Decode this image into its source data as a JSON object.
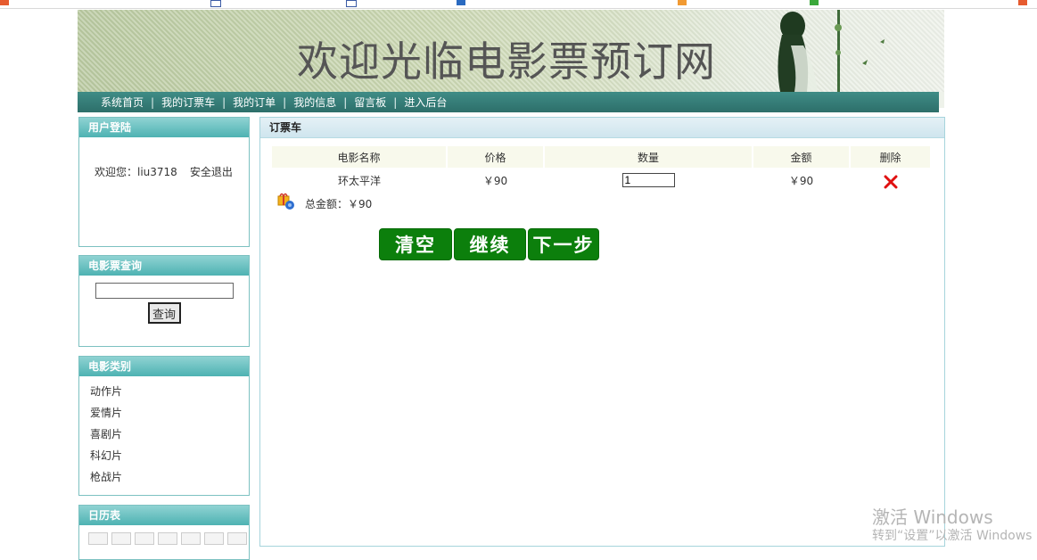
{
  "header": {
    "title": "欢迎光临电影票预订网"
  },
  "nav": {
    "items": [
      {
        "label": "系统首页"
      },
      {
        "label": "我的订票车"
      },
      {
        "label": "我的订单"
      },
      {
        "label": "我的信息"
      },
      {
        "label": "留言板"
      },
      {
        "label": "进入后台"
      }
    ]
  },
  "login_box": {
    "title": "用户登陆",
    "welcome": "欢迎您：liu3718",
    "logout": "安全退出"
  },
  "search_box": {
    "title": "电影票查询",
    "input_value": "",
    "button_label": "查询"
  },
  "category_box": {
    "title": "电影类别",
    "items": [
      "动作片",
      "爱情片",
      "喜剧片",
      "科幻片",
      "枪战片"
    ]
  },
  "calendar_box": {
    "title": "日历表"
  },
  "cart": {
    "title": "订票车",
    "columns": [
      "电影名称",
      "价格",
      "数量",
      "金额",
      "删除"
    ],
    "rows": [
      {
        "name": "环太平洋",
        "price": "￥90",
        "qty": "1",
        "amount": "￥90"
      }
    ],
    "total": "总金额：￥90",
    "buttons": {
      "clear": "清空",
      "continue": "继续",
      "next": "下一步"
    }
  },
  "watermark": {
    "line1": "激活 Windows",
    "line2": "转到“设置”以激活 Windows"
  },
  "colors": {
    "nav_bg": "#2d6f6a",
    "box_head": "#4db2b2",
    "button_green": "#0c7f0c",
    "delete_red": "#e01010"
  }
}
